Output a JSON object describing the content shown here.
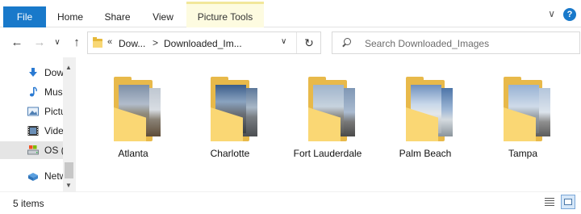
{
  "ribbon": {
    "file_tab": "File",
    "tabs": [
      "Home",
      "Share",
      "View"
    ],
    "contextual_tab": "Picture Tools",
    "collapse_glyph": "∨",
    "help_glyph": "?"
  },
  "navigation": {
    "back_glyph": "←",
    "forward_glyph": "→",
    "recent_glyph": "∨",
    "up_glyph": "↑"
  },
  "address_bar": {
    "overflow_glyph": "«",
    "segment_1": "Dow...",
    "separator": ">",
    "segment_2": "Downloaded_Im...",
    "dropdown_glyph": "∨",
    "refresh_glyph": "↻"
  },
  "search": {
    "placeholder": "Search Downloaded_Images"
  },
  "nav_pane": {
    "items": [
      {
        "label": "Downloads",
        "icon": "download-icon"
      },
      {
        "label": "Music",
        "icon": "music-icon"
      },
      {
        "label": "Pictures",
        "icon": "pictures-icon"
      },
      {
        "label": "Videos",
        "icon": "videos-icon"
      },
      {
        "label": "OS (C:)",
        "icon": "drive-icon"
      },
      {
        "label": "Network",
        "icon": "network-icon"
      }
    ]
  },
  "folders": [
    {
      "name": "Atlanta"
    },
    {
      "name": "Charlotte"
    },
    {
      "name": "Fort Lauderdale"
    },
    {
      "name": "Palm Beach"
    },
    {
      "name": "Tampa"
    }
  ],
  "status_bar": {
    "item_count": "5 items"
  },
  "colors": {
    "file_tab": "#1979ca",
    "folder_back": "#e8b94a",
    "folder_front": "#fad774",
    "contextual_tab_bg": "#fdfbe0"
  }
}
